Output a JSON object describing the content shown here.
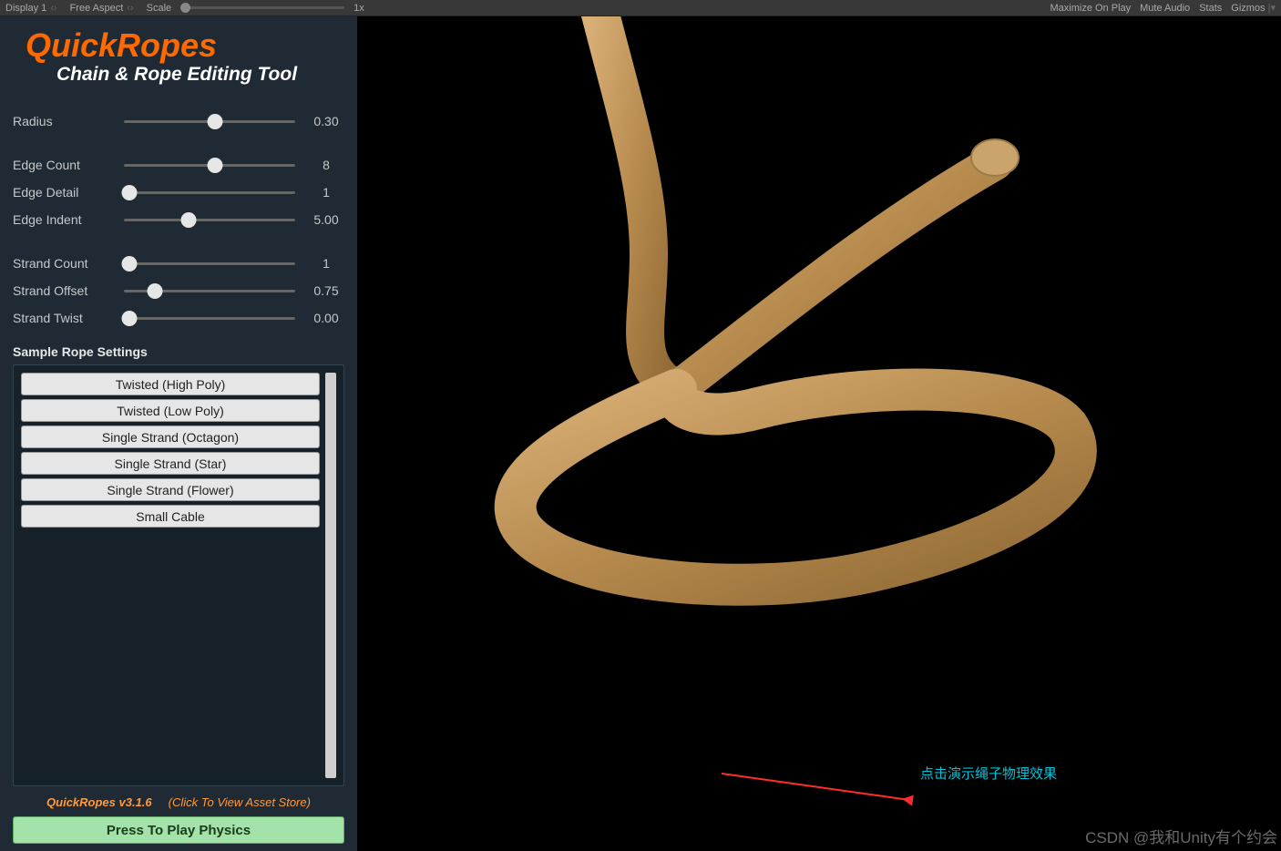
{
  "toolbar": {
    "display_label": "Display 1",
    "aspect_label": "Free Aspect",
    "scale_label": "Scale",
    "scale_value": "1x",
    "right": {
      "maximize": "Maximize On Play",
      "mute": "Mute Audio",
      "stats": "Stats",
      "gizmos": "Gizmos"
    }
  },
  "brand": {
    "title": "QuickRopes",
    "subtitle": "Chain & Rope Editing Tool"
  },
  "props": {
    "radius": {
      "label": "Radius",
      "value": "0.30",
      "pos": 53
    },
    "edge_count": {
      "label": "Edge Count",
      "value": "8",
      "pos": 53
    },
    "edge_detail": {
      "label": "Edge Detail",
      "value": "1",
      "pos": 3
    },
    "edge_indent": {
      "label": "Edge Indent",
      "value": "5.00",
      "pos": 38
    },
    "strand_count": {
      "label": "Strand Count",
      "value": "1",
      "pos": 3
    },
    "strand_offset": {
      "label": "Strand Offset",
      "value": "0.75",
      "pos": 18
    },
    "strand_twist": {
      "label": "Strand Twist",
      "value": "0.00",
      "pos": 3
    }
  },
  "presets": {
    "header": "Sample Rope Settings",
    "items": [
      "Twisted (High Poly)",
      "Twisted (Low Poly)",
      "Single Strand (Octagon)",
      "Single Strand (Star)",
      "Single Strand (Flower)",
      "Small Cable"
    ]
  },
  "footer": {
    "version": "QuickRopes v3.1.6",
    "store_link": "(Click To View Asset Store)",
    "play_button": "Press To Play Physics"
  },
  "annotation": "点击演示绳子物理效果",
  "watermark": "CSDN @我和Unity有个约会"
}
